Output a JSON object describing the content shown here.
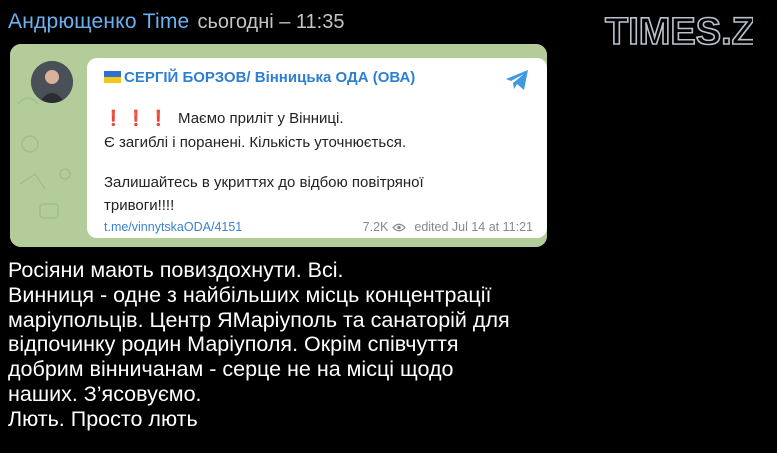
{
  "header": {
    "author": "Андрющенко Time",
    "time": "сьогодні – 11:35"
  },
  "watermark": {
    "text": "TIMES.ZT"
  },
  "embed": {
    "source_name": "СЕРГІЙ БОРЗОВ/ Вінницька ОДА (ОВА)",
    "exclamations": "❗❗❗",
    "lines": [
      "Маємо приліт у Вінниці.",
      "Є загиблі і поранені. Кількість уточнюється.",
      "",
      "Залишайтесь в укриттях до відбою повітряної",
      "тривоги!!!!"
    ],
    "link": "t.me/vinnytskaODA/4151",
    "views": "7.2K",
    "edited": "edited  Jul 14 at 11:21"
  },
  "message": {
    "lines": [
      "Росіяни мають повиздохнути. Всі.",
      "Винниця - одне з найбільших місць концентрації",
      "маріупольців. Центр ЯМаріуполь та санаторій для",
      "відпочинку родин Маріуполя. Окрім співчуття",
      "добрим вінничанам - серце не на місці щодо",
      "наших. З’ясовуємо.",
      "Лють. Просто лють"
    ]
  },
  "colors": {
    "author": "#6ab2f2",
    "link": "#3b82c9",
    "source": "#2f7fd1",
    "embed_bg": "#b7cf9f"
  }
}
